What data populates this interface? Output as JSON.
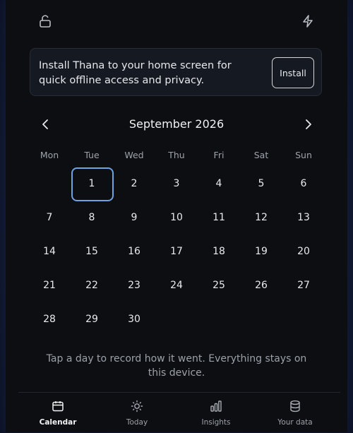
{
  "topbar": {
    "lock_icon": "unlock-icon",
    "bolt_icon": "lightning-icon"
  },
  "banner": {
    "text": "Install Thana to your home screen for quick offline access and privacy.",
    "install_label": "Install"
  },
  "calendar": {
    "month_title": "September 2026",
    "prev_icon": "chevron-left-icon",
    "next_icon": "chevron-right-icon",
    "weekdays": [
      "Mon",
      "Tue",
      "Wed",
      "Thu",
      "Fri",
      "Sat",
      "Sun"
    ],
    "first_weekday_index": 1,
    "days": [
      "1",
      "2",
      "3",
      "4",
      "5",
      "6",
      "7",
      "8",
      "9",
      "10",
      "11",
      "12",
      "13",
      "14",
      "15",
      "16",
      "17",
      "18",
      "19",
      "20",
      "21",
      "22",
      "23",
      "24",
      "25",
      "26",
      "27",
      "28",
      "29",
      "30"
    ],
    "selected_day": "1"
  },
  "hint": "Tap a day to record how it went. Everything stays on this device.",
  "bottom_nav": {
    "items": [
      {
        "label": "Calendar",
        "icon": "calendar-icon",
        "active": true
      },
      {
        "label": "Today",
        "icon": "sun-icon",
        "active": false
      },
      {
        "label": "Insights",
        "icon": "bar-chart-icon",
        "active": false
      },
      {
        "label": "Your data",
        "icon": "database-icon",
        "active": false
      }
    ]
  },
  "colors": {
    "background": "#0d0e11",
    "accent": "#6ea2e3",
    "banner_bg": "#151a22"
  }
}
